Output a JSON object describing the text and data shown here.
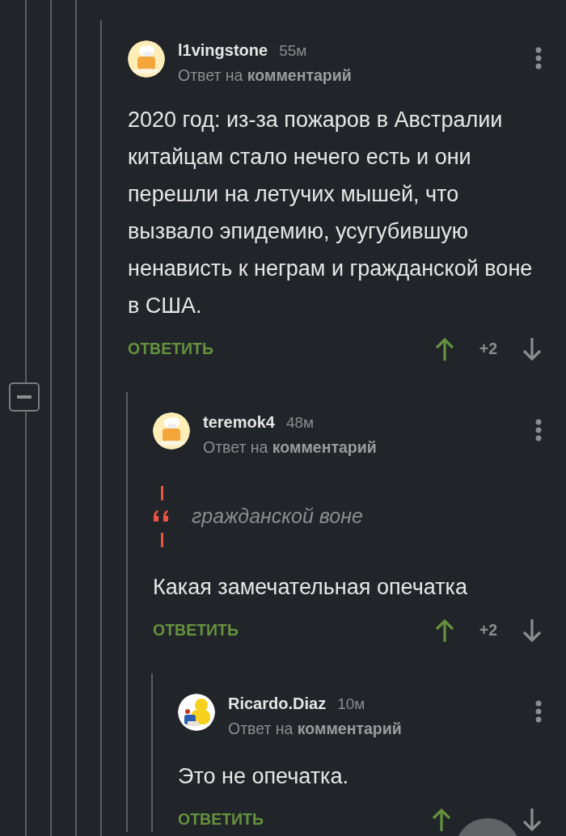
{
  "comments": [
    {
      "author": "l1vingstone",
      "time": "55м",
      "reply_info": "Ответ на **комментарий**",
      "body": "2020 год: из-за пожаров в Австралии китайцам стало нечего есть и они перешли на летучих мышей, что вызвало эпидемию, усугубившую ненависть к неграм и гражданской воне в США.",
      "reply_label": "ОТВЕТИТЬ",
      "rating": "+2",
      "children": [
        {
          "author": "teremok4",
          "time": "48м",
          "reply_info": "Ответ на **комментарий**",
          "quote": "гражданской воне",
          "body": "Какая замечательная опечатка",
          "reply_label": "ОТВЕТИТЬ",
          "rating": "+2",
          "children": [
            {
              "author": "Ricardo.Diaz",
              "time": "10м",
              "reply_info": "Ответ на **комментарий**",
              "body": "Это не опечатка.",
              "reply_label": "ОТВЕТИТЬ"
            }
          ]
        }
      ]
    }
  ]
}
